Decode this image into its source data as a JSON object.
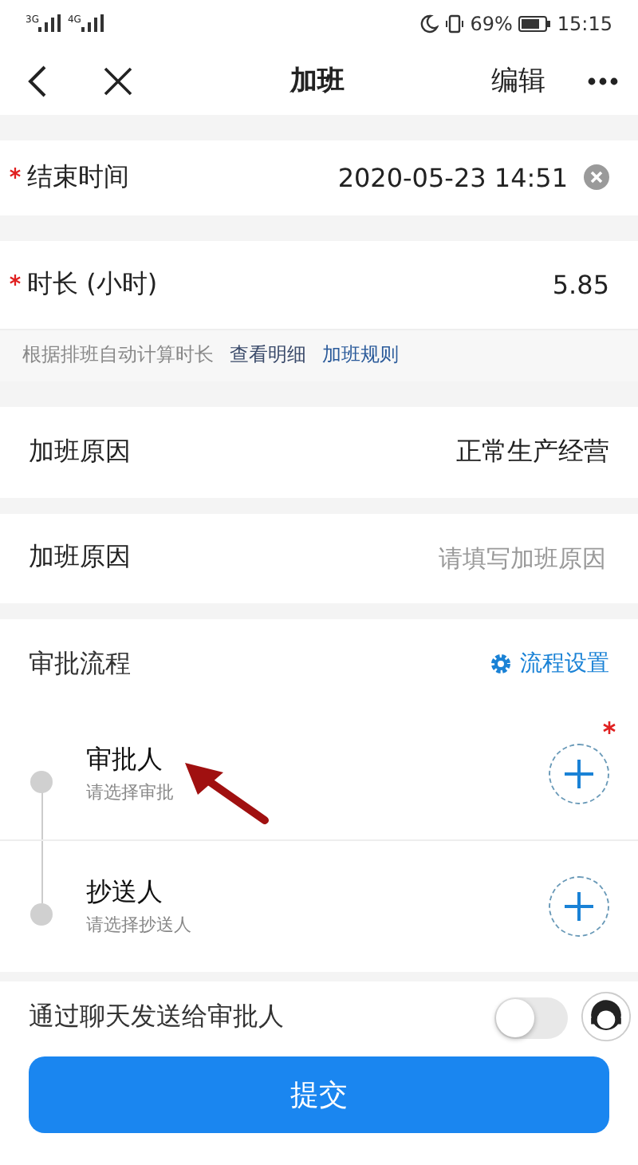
{
  "status_bar": {
    "signal_labels": [
      "3G",
      "4G"
    ],
    "battery_percent": "69%",
    "time": "15:15"
  },
  "nav": {
    "title": "加班",
    "edit": "编辑"
  },
  "fields": [
    {
      "kind": "datetime",
      "label": "结束时间",
      "required": true,
      "value": "2020-05-23 14:51"
    },
    {
      "kind": "value",
      "label": "时长 (小时)",
      "required": true,
      "value": "5.85"
    }
  ],
  "hint": {
    "text": "根据排班自动计算时长",
    "links": [
      "查看明细",
      "加班规则"
    ]
  },
  "reason_fields": [
    {
      "label": "加班原因",
      "value": "正常生产经营"
    },
    {
      "label": "加班原因",
      "placeholder": "请填写加班原因"
    }
  ],
  "approval": {
    "title": "审批流程",
    "settings_link": "流程设置",
    "steps": [
      {
        "name": "审批人",
        "hint": "请选择审批",
        "required": true
      },
      {
        "name": "抄送人",
        "hint": "请选择抄送人",
        "required": false
      }
    ]
  },
  "chat_toggle": {
    "label": "通过聊天发送给审批人",
    "on": false
  },
  "submit": "提交"
}
